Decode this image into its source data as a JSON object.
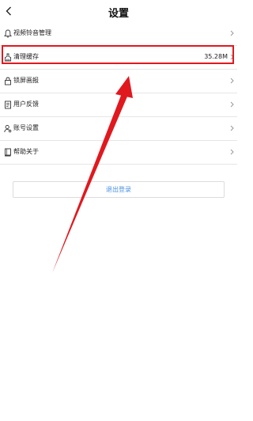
{
  "header": {
    "title": "设置",
    "back_icon": "chevron-left-icon"
  },
  "items": [
    {
      "label": "视频铃音管理",
      "icon": "bell-icon",
      "value": ""
    },
    {
      "label": "清理缓存",
      "icon": "broom-icon",
      "value": "35.28M"
    },
    {
      "label": "锁屏画报",
      "icon": "lock-icon",
      "value": ""
    },
    {
      "label": "用户反馈",
      "icon": "feedback-icon",
      "value": ""
    },
    {
      "label": "账号设置",
      "icon": "user-gear-icon",
      "value": ""
    },
    {
      "label": "帮助关于",
      "icon": "help-book-icon",
      "value": ""
    }
  ],
  "logout_label": "退出登录",
  "annotation_color": "#e0191f"
}
